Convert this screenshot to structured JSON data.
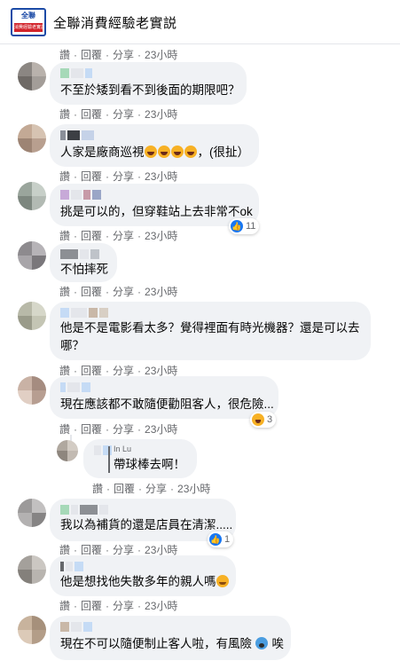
{
  "header": {
    "group_name": "全聯消費經驗老實説",
    "logo_top": "全聯",
    "logo_sub": "消費經驗老實説"
  },
  "actions": {
    "like": "讚",
    "reply": "回覆",
    "share": "分享",
    "sep": "·"
  },
  "comments": [
    {
      "text": "",
      "time": "23小時"
    },
    {
      "text": "不至於矮到看不到後面的期限吧？",
      "time": "23小時"
    },
    {
      "text": "人家是廠商巡視",
      "suffix": "，(很扯）",
      "time": "23小時"
    },
    {
      "text": "挑是可以的，但穿鞋站上去非常不ok",
      "time": "23小時",
      "reactions": "11"
    },
    {
      "text": "不怕摔死",
      "time": "23小時"
    },
    {
      "text": "他是不是電影看太多？覺得裡面有時光機器？還是可以去哪？",
      "time": "23小時"
    },
    {
      "text": "現在應該都不敢隨便勸阻客人，很危險...",
      "time": "23小時",
      "reactions": "3"
    },
    {
      "text": "帶球棒去啊！",
      "quote_name": "In Lu",
      "time": "23小時"
    },
    {
      "text": "我以為補貨的還是店員在清潔.....",
      "time": "23小時",
      "reactions": "1"
    },
    {
      "text": "他是想找他失散多年的親人嗎",
      "time": "23小時"
    },
    {
      "text": "現在不可以隨便制止客人啦，有風險",
      "suffix": "唉",
      "time": ""
    }
  ],
  "colors": {
    "bubble": "#f0f2f5",
    "meta": "#65676b",
    "like_blue": "#1877f2",
    "brand_blue": "#1b4aa6",
    "brand_red": "#d2232a"
  }
}
